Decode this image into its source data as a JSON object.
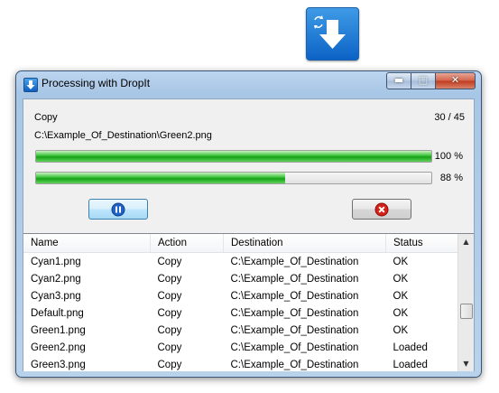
{
  "window": {
    "title": "Processing with DropIt"
  },
  "caption": {
    "minimize": "▬",
    "maximize": "□",
    "close": "✕"
  },
  "operation": {
    "action": "Copy",
    "counter": "30 / 45",
    "current_path": "C:\\Example_Of_Destination\\Green2.png"
  },
  "progress": {
    "file_percent_label": "100 %",
    "file_fraction": 1.0,
    "total_percent_label": "88 %",
    "total_fraction": 0.63
  },
  "list": {
    "columns": [
      "Name",
      "Action",
      "Destination",
      "Status"
    ],
    "rows": [
      [
        "Cyan1.png",
        "Copy",
        "C:\\Example_Of_Destination",
        "OK"
      ],
      [
        "Cyan2.png",
        "Copy",
        "C:\\Example_Of_Destination",
        "OK"
      ],
      [
        "Cyan3.png",
        "Copy",
        "C:\\Example_Of_Destination",
        "OK"
      ],
      [
        "Default.png",
        "Copy",
        "C:\\Example_Of_Destination",
        "OK"
      ],
      [
        "Green1.png",
        "Copy",
        "C:\\Example_Of_Destination",
        "OK"
      ],
      [
        "Green2.png",
        "Copy",
        "C:\\Example_Of_Destination",
        "Loaded"
      ],
      [
        "Green3.png",
        "Copy",
        "C:\\Example_Of_Destination",
        "Loaded"
      ]
    ],
    "scroll_up": "▲",
    "scroll_down": "▼"
  },
  "icons": {
    "drop_target": "arrow-down-icon",
    "pause": "pause-icon",
    "cancel": "close-icon"
  },
  "colors": {
    "progress": "#22b022",
    "accent": "#0c63c6",
    "cancel": "#d2231b"
  }
}
